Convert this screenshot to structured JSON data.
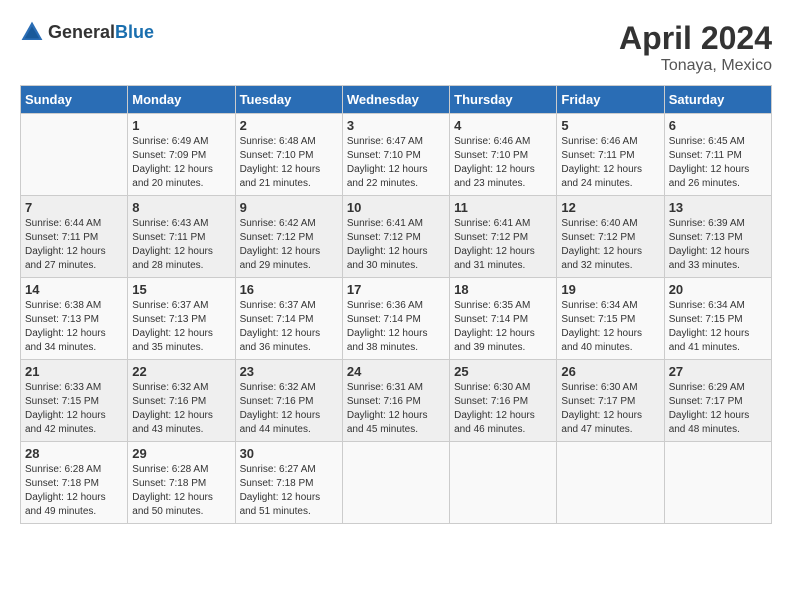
{
  "header": {
    "logo_general": "General",
    "logo_blue": "Blue",
    "month_year": "April 2024",
    "location": "Tonaya, Mexico"
  },
  "weekdays": [
    "Sunday",
    "Monday",
    "Tuesday",
    "Wednesday",
    "Thursday",
    "Friday",
    "Saturday"
  ],
  "weeks": [
    [
      {
        "day": "",
        "sunrise": "",
        "sunset": "",
        "daylight": ""
      },
      {
        "day": "1",
        "sunrise": "Sunrise: 6:49 AM",
        "sunset": "Sunset: 7:09 PM",
        "daylight": "Daylight: 12 hours and 20 minutes."
      },
      {
        "day": "2",
        "sunrise": "Sunrise: 6:48 AM",
        "sunset": "Sunset: 7:10 PM",
        "daylight": "Daylight: 12 hours and 21 minutes."
      },
      {
        "day": "3",
        "sunrise": "Sunrise: 6:47 AM",
        "sunset": "Sunset: 7:10 PM",
        "daylight": "Daylight: 12 hours and 22 minutes."
      },
      {
        "day": "4",
        "sunrise": "Sunrise: 6:46 AM",
        "sunset": "Sunset: 7:10 PM",
        "daylight": "Daylight: 12 hours and 23 minutes."
      },
      {
        "day": "5",
        "sunrise": "Sunrise: 6:46 AM",
        "sunset": "Sunset: 7:11 PM",
        "daylight": "Daylight: 12 hours and 24 minutes."
      },
      {
        "day": "6",
        "sunrise": "Sunrise: 6:45 AM",
        "sunset": "Sunset: 7:11 PM",
        "daylight": "Daylight: 12 hours and 26 minutes."
      }
    ],
    [
      {
        "day": "7",
        "sunrise": "Sunrise: 6:44 AM",
        "sunset": "Sunset: 7:11 PM",
        "daylight": "Daylight: 12 hours and 27 minutes."
      },
      {
        "day": "8",
        "sunrise": "Sunrise: 6:43 AM",
        "sunset": "Sunset: 7:11 PM",
        "daylight": "Daylight: 12 hours and 28 minutes."
      },
      {
        "day": "9",
        "sunrise": "Sunrise: 6:42 AM",
        "sunset": "Sunset: 7:12 PM",
        "daylight": "Daylight: 12 hours and 29 minutes."
      },
      {
        "day": "10",
        "sunrise": "Sunrise: 6:41 AM",
        "sunset": "Sunset: 7:12 PM",
        "daylight": "Daylight: 12 hours and 30 minutes."
      },
      {
        "day": "11",
        "sunrise": "Sunrise: 6:41 AM",
        "sunset": "Sunset: 7:12 PM",
        "daylight": "Daylight: 12 hours and 31 minutes."
      },
      {
        "day": "12",
        "sunrise": "Sunrise: 6:40 AM",
        "sunset": "Sunset: 7:12 PM",
        "daylight": "Daylight: 12 hours and 32 minutes."
      },
      {
        "day": "13",
        "sunrise": "Sunrise: 6:39 AM",
        "sunset": "Sunset: 7:13 PM",
        "daylight": "Daylight: 12 hours and 33 minutes."
      }
    ],
    [
      {
        "day": "14",
        "sunrise": "Sunrise: 6:38 AM",
        "sunset": "Sunset: 7:13 PM",
        "daylight": "Daylight: 12 hours and 34 minutes."
      },
      {
        "day": "15",
        "sunrise": "Sunrise: 6:37 AM",
        "sunset": "Sunset: 7:13 PM",
        "daylight": "Daylight: 12 hours and 35 minutes."
      },
      {
        "day": "16",
        "sunrise": "Sunrise: 6:37 AM",
        "sunset": "Sunset: 7:14 PM",
        "daylight": "Daylight: 12 hours and 36 minutes."
      },
      {
        "day": "17",
        "sunrise": "Sunrise: 6:36 AM",
        "sunset": "Sunset: 7:14 PM",
        "daylight": "Daylight: 12 hours and 38 minutes."
      },
      {
        "day": "18",
        "sunrise": "Sunrise: 6:35 AM",
        "sunset": "Sunset: 7:14 PM",
        "daylight": "Daylight: 12 hours and 39 minutes."
      },
      {
        "day": "19",
        "sunrise": "Sunrise: 6:34 AM",
        "sunset": "Sunset: 7:15 PM",
        "daylight": "Daylight: 12 hours and 40 minutes."
      },
      {
        "day": "20",
        "sunrise": "Sunrise: 6:34 AM",
        "sunset": "Sunset: 7:15 PM",
        "daylight": "Daylight: 12 hours and 41 minutes."
      }
    ],
    [
      {
        "day": "21",
        "sunrise": "Sunrise: 6:33 AM",
        "sunset": "Sunset: 7:15 PM",
        "daylight": "Daylight: 12 hours and 42 minutes."
      },
      {
        "day": "22",
        "sunrise": "Sunrise: 6:32 AM",
        "sunset": "Sunset: 7:16 PM",
        "daylight": "Daylight: 12 hours and 43 minutes."
      },
      {
        "day": "23",
        "sunrise": "Sunrise: 6:32 AM",
        "sunset": "Sunset: 7:16 PM",
        "daylight": "Daylight: 12 hours and 44 minutes."
      },
      {
        "day": "24",
        "sunrise": "Sunrise: 6:31 AM",
        "sunset": "Sunset: 7:16 PM",
        "daylight": "Daylight: 12 hours and 45 minutes."
      },
      {
        "day": "25",
        "sunrise": "Sunrise: 6:30 AM",
        "sunset": "Sunset: 7:16 PM",
        "daylight": "Daylight: 12 hours and 46 minutes."
      },
      {
        "day": "26",
        "sunrise": "Sunrise: 6:30 AM",
        "sunset": "Sunset: 7:17 PM",
        "daylight": "Daylight: 12 hours and 47 minutes."
      },
      {
        "day": "27",
        "sunrise": "Sunrise: 6:29 AM",
        "sunset": "Sunset: 7:17 PM",
        "daylight": "Daylight: 12 hours and 48 minutes."
      }
    ],
    [
      {
        "day": "28",
        "sunrise": "Sunrise: 6:28 AM",
        "sunset": "Sunset: 7:18 PM",
        "daylight": "Daylight: 12 hours and 49 minutes."
      },
      {
        "day": "29",
        "sunrise": "Sunrise: 6:28 AM",
        "sunset": "Sunset: 7:18 PM",
        "daylight": "Daylight: 12 hours and 50 minutes."
      },
      {
        "day": "30",
        "sunrise": "Sunrise: 6:27 AM",
        "sunset": "Sunset: 7:18 PM",
        "daylight": "Daylight: 12 hours and 51 minutes."
      },
      {
        "day": "",
        "sunrise": "",
        "sunset": "",
        "daylight": ""
      },
      {
        "day": "",
        "sunrise": "",
        "sunset": "",
        "daylight": ""
      },
      {
        "day": "",
        "sunrise": "",
        "sunset": "",
        "daylight": ""
      },
      {
        "day": "",
        "sunrise": "",
        "sunset": "",
        "daylight": ""
      }
    ]
  ]
}
